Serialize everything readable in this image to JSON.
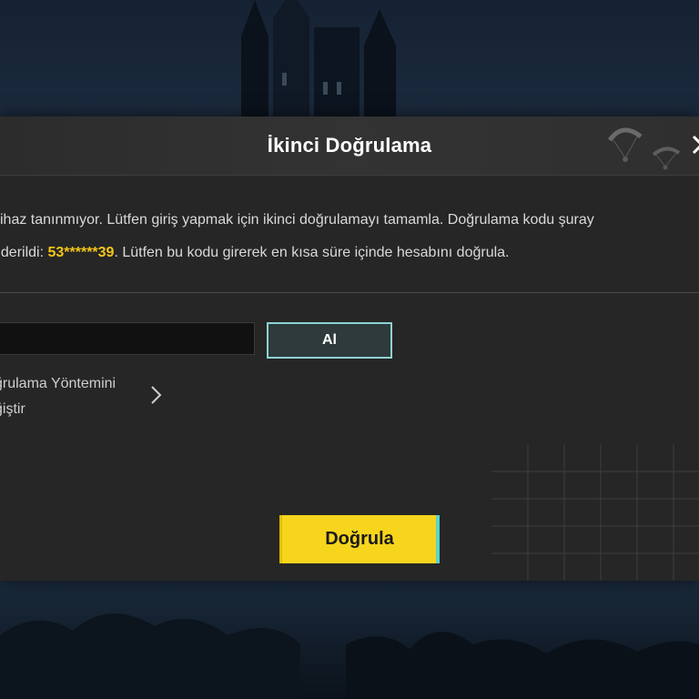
{
  "dialog": {
    "title": "İkinci Doğrulama",
    "close_icon": "close-icon",
    "message": {
      "line1": "cihaz tanınmıyor. Lütfen giriş yapmak için ikinci doğrulamayı tamamla. Doğrulama kodu şuray",
      "line2_prefix": "nderildi: ",
      "masked_contact": "53******39",
      "line2_suffix": ". Lütfen bu kodu girerek en kısa süre içinde hesabını doğrula."
    },
    "code_input": {
      "value": "",
      "placeholder": ""
    },
    "get_code_label": "Al",
    "change_method": {
      "line1": "ğrulama Yöntemini",
      "line2": "ğiştir",
      "icon": "chevron-right-icon"
    },
    "verify_label": "Doğrula"
  },
  "colors": {
    "dialog_bg": "#262626",
    "accent_yellow": "#f7d51d",
    "masked_text": "#f5c518",
    "get_code_border": "#8fd3d3"
  }
}
